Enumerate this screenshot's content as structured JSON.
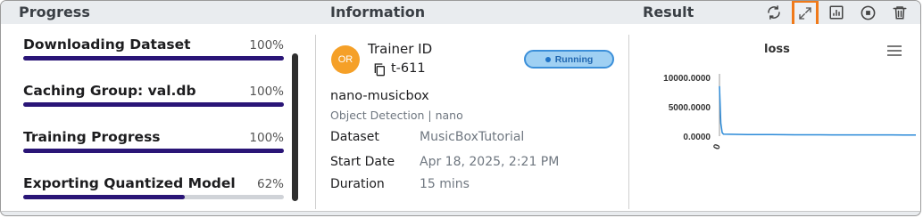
{
  "header": {
    "progress_title": "Progress",
    "information_title": "Information",
    "result_title": "Result",
    "icons": [
      "refresh-icon",
      "expand-icon",
      "chart-icon",
      "stop-icon",
      "trash-icon"
    ],
    "active_icon": "expand-icon",
    "active_color": "#f07a1a"
  },
  "progress": {
    "items": [
      {
        "label": "Downloading Dataset",
        "percent_label": "100%",
        "value": 100
      },
      {
        "label": "Caching Group: val.db",
        "percent_label": "100%",
        "value": 100
      },
      {
        "label": "Training Progress",
        "percent_label": "100%",
        "value": 100
      },
      {
        "label": "Exporting Quantized Model",
        "percent_label": "62%",
        "value": 62
      }
    ],
    "bar_color": "#2a1577"
  },
  "info": {
    "avatar": "OR",
    "trainer_label": "Trainer ID",
    "trainer_id": "t-611",
    "status": "Running",
    "model_name": "nano-musicbox",
    "model_sub": "Object Detection | nano",
    "rows": [
      {
        "label": "Dataset",
        "value": "MusicBoxTutorial"
      },
      {
        "label": "Start Date",
        "value": "Apr 18, 2025, 2:21 PM"
      },
      {
        "label": "Duration",
        "value": "15 mins"
      }
    ]
  },
  "result": {
    "title": "loss"
  },
  "chart_data": {
    "type": "line",
    "title": "loss",
    "ylim": [
      0,
      10000
    ],
    "y_ticks": [
      "10000.0000",
      "5000.0000",
      "0.0000"
    ],
    "x_ticks": [
      "0"
    ],
    "series": [
      {
        "values": [
          8500,
          2200,
          600,
          350,
          300,
          280,
          260,
          250,
          240,
          230,
          225,
          220,
          215,
          212,
          210,
          208,
          206,
          205,
          204,
          203
        ]
      }
    ],
    "line_color": "#2b8ad8",
    "grid": false,
    "legend": "none"
  }
}
